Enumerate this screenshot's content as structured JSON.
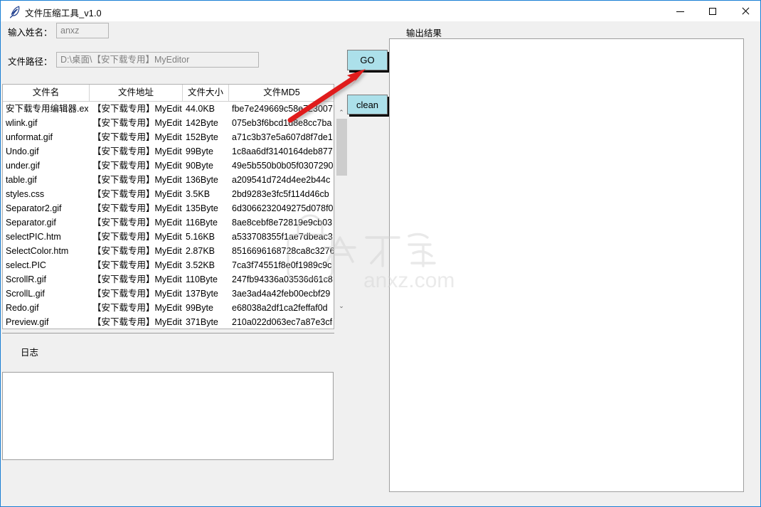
{
  "window": {
    "title": "文件压缩工具_v1.0",
    "icon": "feather-quill-icon",
    "minimize_label": "—",
    "maximize_label": "□",
    "close_label": "✕",
    "accent_border": "#1a7fd4",
    "chrome_bg": "#f0f0f0"
  },
  "form": {
    "name_label": "输入姓名：",
    "name_value": "anxz",
    "path_label": "文件路径：",
    "path_value": "D:\\桌面\\【安下载专用】MyEditor"
  },
  "buttons": {
    "go_label": "GO",
    "clean_label": "clean",
    "button_color": "#ace0ea"
  },
  "output": {
    "label": "输出结果",
    "content": ""
  },
  "log": {
    "label": "日志",
    "content": ""
  },
  "table": {
    "headers": [
      "文件名",
      "文件地址",
      "文件大小",
      "文件MD5"
    ],
    "rows": [
      {
        "name": "安下载专用编辑器.ex",
        "addr": "【安下载专用】MyEdit",
        "size": "44.0KB",
        "md5": "fbe7e249669c58e723007"
      },
      {
        "name": "wlink.gif",
        "addr": "【安下载专用】MyEdit",
        "size": "142Byte",
        "md5": "075eb3f6bcd1d8e8cc7ba"
      },
      {
        "name": "unformat.gif",
        "addr": "【安下载专用】MyEdit",
        "size": "152Byte",
        "md5": "a71c3b37e5a607d8f7de1"
      },
      {
        "name": "Undo.gif",
        "addr": "【安下载专用】MyEdit",
        "size": "99Byte",
        "md5": "1c8aa6df3140164deb877"
      },
      {
        "name": "under.gif",
        "addr": "【安下载专用】MyEdit",
        "size": "90Byte",
        "md5": "49e5b550b0b05f0307290"
      },
      {
        "name": "table.gif",
        "addr": "【安下载专用】MyEdit",
        "size": "136Byte",
        "md5": "a209541d724d4ee2b44c"
      },
      {
        "name": "styles.css",
        "addr": "【安下载专用】MyEdit",
        "size": "3.5KB",
        "md5": "2bd9283e3fc5f114d46cb"
      },
      {
        "name": "Separator2.gif",
        "addr": "【安下载专用】MyEdit",
        "size": "135Byte",
        "md5": "6d3066232049275d078f0"
      },
      {
        "name": "Separator.gif",
        "addr": "【安下载专用】MyEdit",
        "size": "116Byte",
        "md5": "8ae8cebf8e72819e9cb03"
      },
      {
        "name": "selectPIC.htm",
        "addr": "【安下载专用】MyEdit",
        "size": "5.16KB",
        "md5": "a533708355f1ae7dbeac3"
      },
      {
        "name": "SelectColor.htm",
        "addr": "【安下载专用】MyEdit",
        "size": "2.87KB",
        "md5": "8516696168728ca8c3276"
      },
      {
        "name": "select.PIC",
        "addr": "【安下载专用】MyEdit",
        "size": "3.52KB",
        "md5": "7ca3f74551f8e0f1989c9c"
      },
      {
        "name": "ScrollR.gif",
        "addr": "【安下载专用】MyEdit",
        "size": "110Byte",
        "md5": "247fb94336a03536d61c8"
      },
      {
        "name": "ScrollL.gif",
        "addr": "【安下载专用】MyEdit",
        "size": "137Byte",
        "md5": "3ae3ad4a42feb00ecbf29"
      },
      {
        "name": "Redo.gif",
        "addr": "【安下载专用】MyEdit",
        "size": "99Byte",
        "md5": "e68038a2df1ca2feffaf0d"
      },
      {
        "name": "Preview.gif",
        "addr": "【安下载专用】MyEdit",
        "size": "371Byte",
        "md5": "210a022d063ec7a87e3cf"
      }
    ]
  },
  "scrollbar": {
    "up_arrow": "⌃",
    "down_arrow": "⌄"
  },
  "annotation": {
    "arrow_color": "#e01b1b"
  },
  "watermark": {
    "text": "安下载",
    "domain": "anxz.com"
  }
}
